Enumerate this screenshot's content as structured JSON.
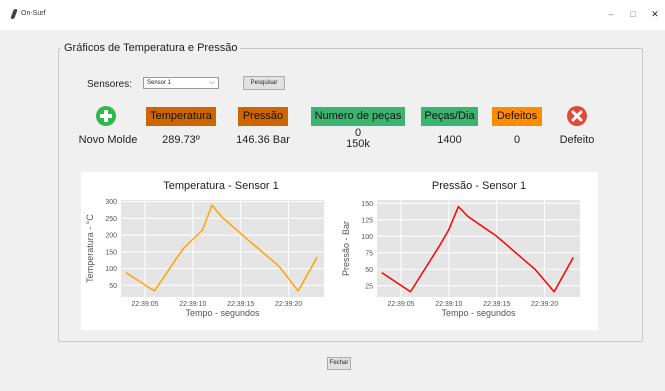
{
  "window": {
    "title": "On-Surf",
    "controls": [
      "–",
      "□",
      "✕"
    ]
  },
  "group_title": "Gráficos de Temperatura e Pressão",
  "search": {
    "label": "Sensores:",
    "selected": "Sensor 1",
    "button": "Pesquisar"
  },
  "badges": {
    "temperatura": "Temperatura",
    "pressao": "Pressão",
    "numero_pecas": "Numero de peças",
    "pecas_dia": "Peças/Dia",
    "defeitos": "Defeitos"
  },
  "values": {
    "novo_molde": "Novo Molde",
    "temperatura": "289.73º",
    "pressao": "146.36 Bar",
    "numero_pecas_line1": "0",
    "numero_pecas_line2": "150k",
    "pecas_dia": "1400",
    "defeitos": "0",
    "defeito": "Defeito"
  },
  "icons": {
    "add": "plus-circle-icon",
    "remove": "x-circle-icon"
  },
  "colors": {
    "orange_badge": "#cc6600",
    "green_badge": "#3cb371",
    "defeitos_badge": "#ff8c00",
    "temp_line": "#ffa500",
    "press_line": "#ff0000",
    "plot_bg": "#e5e5e5"
  },
  "chart_data": [
    {
      "type": "line",
      "title": "Temperatura - Sensor 1",
      "xlabel": "Tempo - segundos",
      "ylabel": "Temperatura - °C",
      "x": [
        "22:39:03",
        "22:39:06",
        "22:39:09",
        "22:39:11",
        "22:39:12",
        "22:39:15",
        "22:39:18",
        "22:39:21",
        "22:39:23"
      ],
      "y": [
        88,
        33,
        160,
        215,
        290,
        255,
        180,
        107,
        33,
        135
      ],
      "x_full": [
        "22:39:03",
        "22:39:06",
        "22:39:09",
        "22:39:11",
        "22:39:12",
        "22:39:13",
        "22:39:16",
        "22:39:19",
        "22:39:21",
        "22:39:23"
      ],
      "x_ticks": [
        "22:39:05",
        "22:39:10",
        "22:39:15",
        "22:39:20"
      ],
      "y_ticks": [
        50,
        100,
        150,
        200,
        250,
        300
      ],
      "ylim": [
        15,
        305
      ],
      "grid": true
    },
    {
      "type": "line",
      "title": "Pressão - Sensor 1",
      "xlabel": "Tempo - segundos",
      "ylabel": "Pressão - Bar",
      "x_full": [
        "22:39:03",
        "22:39:06",
        "22:39:09",
        "22:39:10",
        "22:39:11",
        "22:39:12",
        "22:39:15",
        "22:39:17",
        "22:39:19",
        "22:39:21",
        "22:39:23"
      ],
      "y": [
        45,
        16,
        85,
        110,
        145,
        130,
        100,
        75,
        50,
        16,
        68
      ],
      "x_ticks": [
        "22:39:05",
        "22:39:10",
        "22:39:15",
        "22:39:20"
      ],
      "y_ticks": [
        25,
        50,
        75,
        100,
        125,
        150
      ],
      "ylim": [
        8,
        155
      ],
      "grid": true
    }
  ],
  "footer": {
    "close_button": "Fechar"
  }
}
